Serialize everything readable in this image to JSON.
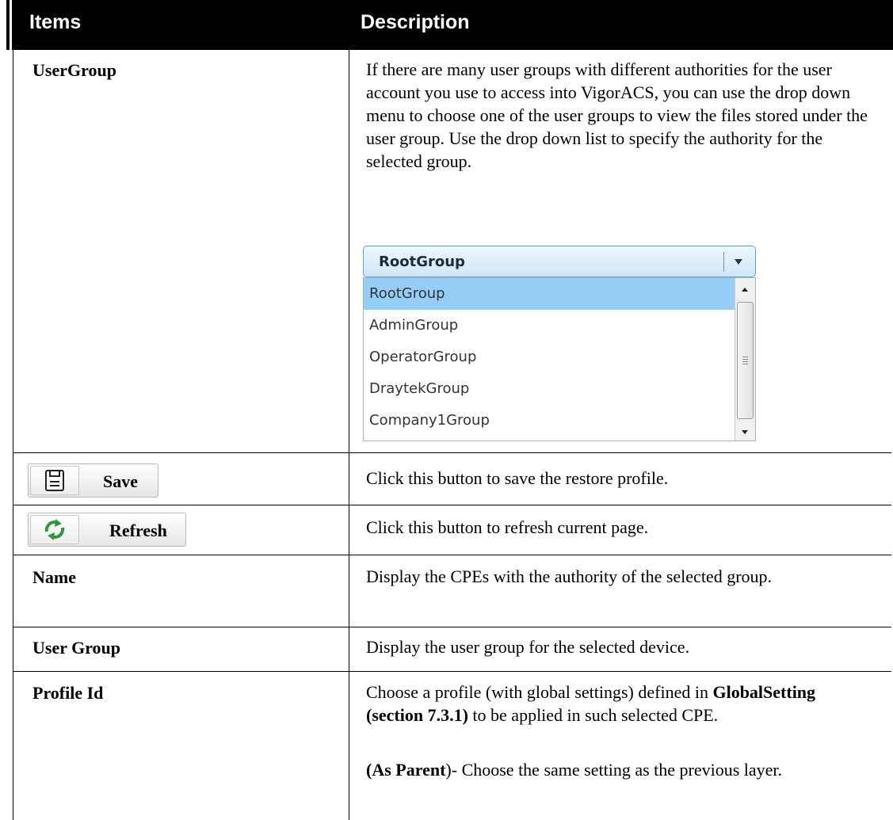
{
  "header": {
    "items": "Items",
    "description": "Description"
  },
  "rows": {
    "usergroup": {
      "item": "UserGroup",
      "desc": "If there are many user groups with different authorities for the user account you use to access into VigorACS, you can use the drop down menu to choose one of the user groups to view the files stored under the user group. Use the drop down list to specify the authority for the selected group."
    },
    "save": {
      "item": "Save",
      "desc": "Click this button to save the restore profile.",
      "icon": "floppy-disk-icon"
    },
    "refresh": {
      "item": "Refresh",
      "desc": "Click this button to refresh current page.",
      "icon": "refresh-arrows-icon"
    },
    "name": {
      "item": "Name",
      "desc": "Display the CPEs with the authority of the selected group."
    },
    "user_group": {
      "item": "User Group",
      "desc": "Display the user group for the selected device."
    },
    "profile_id": {
      "item": "Profile Id",
      "desc_pre": "Choose a profile (with global settings) defined in ",
      "desc_bold": "GlobalSetting (section 7.3.1)",
      "desc_post": " to be applied in such selected CPE.",
      "desc2_bold": "(As Parent",
      "desc2_rest": ")- Choose the same setting as the previous layer."
    }
  },
  "dropdown": {
    "selected": "RootGroup",
    "options": [
      "RootGroup",
      "AdminGroup",
      "OperatorGroup",
      "DraytekGroup",
      "Company1Group"
    ],
    "accent": "#94cdf5"
  }
}
